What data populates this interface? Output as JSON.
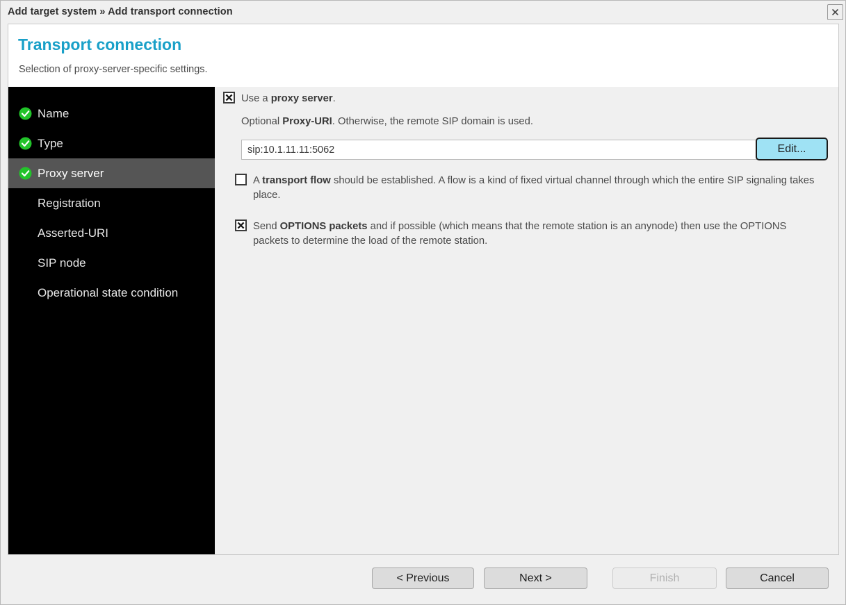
{
  "window": {
    "titlebar": "Add target system » Add transport connection",
    "close_icon": "close-icon"
  },
  "header": {
    "title": "Transport connection",
    "subtitle": "Selection of proxy-server-specific settings.",
    "title_color": "#19a0c8"
  },
  "sidebar": {
    "items": [
      {
        "label": "Name",
        "checked": true,
        "active": false
      },
      {
        "label": "Type",
        "checked": true,
        "active": false
      },
      {
        "label": "Proxy server",
        "checked": true,
        "active": true
      },
      {
        "label": "Registration",
        "checked": false,
        "active": false
      },
      {
        "label": "Asserted-URI",
        "checked": false,
        "active": false
      },
      {
        "label": "SIP node",
        "checked": false,
        "active": false
      },
      {
        "label": "Operational state condition",
        "checked": false,
        "active": false
      }
    ],
    "check_color": "#22c32a",
    "active_bg": "#555555"
  },
  "content": {
    "proxy_checkbox": {
      "checked": true,
      "text_before": "Use a ",
      "text_bold": "proxy server",
      "text_after": "."
    },
    "proxy_uri_hint": {
      "text_before": "Optional ",
      "text_bold": "Proxy-URI",
      "text_after": ". Otherwise, the remote SIP domain is used."
    },
    "proxy_uri_input": {
      "value": "sip:10.1.11.11:5062",
      "placeholder": ""
    },
    "edit_button": {
      "label": "Edit...",
      "color": "#9fe2f4"
    },
    "transport_flow_checkbox": {
      "checked": false,
      "text_before": "A ",
      "text_bold": "transport flow",
      "text_after": " should be established. A flow is a kind of fixed virtual channel through which the entire SIP signaling takes place."
    },
    "options_checkbox": {
      "checked": true,
      "text_before": "Send ",
      "text_bold": "OPTIONS packets",
      "text_after": " and if possible (which means that the remote station is an anynode) then use the OPTIONS packets to determine the load of the remote station."
    }
  },
  "footer": {
    "previous_label": "< Previous",
    "next_label": "Next >",
    "finish_label": "Finish",
    "finish_disabled": true,
    "cancel_label": "Cancel"
  }
}
